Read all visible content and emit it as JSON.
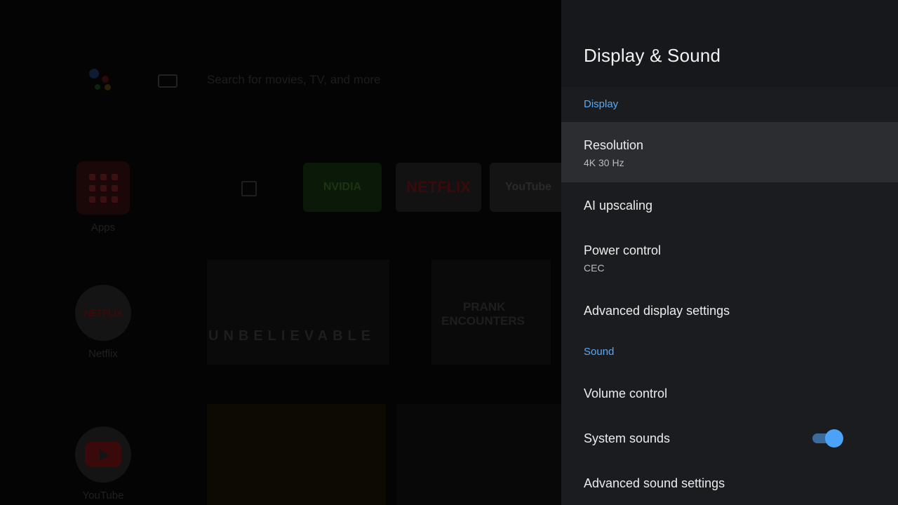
{
  "home": {
    "search_hint": "Search for movies, TV, and more",
    "rail": {
      "apps_label": "Apps",
      "netflix_label": "Netflix",
      "netflix_logo": "NETFLIX",
      "youtube_label": "YouTube"
    },
    "favorites": {
      "nvidia_label": "NVIDIA",
      "netflix_label": "NETFLIX",
      "youtube_label": "YouTube"
    },
    "posters": {
      "unbelievable": "UNBELIEVABLE",
      "prank_line1": "PRANK",
      "prank_line2": "ENCOUNTERS"
    }
  },
  "settings": {
    "title": "Display & Sound",
    "display_section": "Display",
    "sound_section": "Sound",
    "items": [
      {
        "title": "Resolution",
        "subtitle": "4K 30 Hz"
      },
      {
        "title": "AI upscaling"
      },
      {
        "title": "Power control",
        "subtitle": "CEC"
      },
      {
        "title": "Advanced display settings"
      },
      {
        "title": "Volume control"
      },
      {
        "title": "System sounds",
        "toggle_on": true
      },
      {
        "title": "Advanced sound settings"
      }
    ]
  },
  "colors": {
    "accent": "#4aa3f8",
    "section_label": "#5aa9f4",
    "panel_bg": "#1b1c1f",
    "focused_row": "#2c2d31"
  },
  "icons": {
    "assistant": "google-assistant-icon",
    "keyboard": "keyboard-icon",
    "apps": "apps-grid-icon",
    "external": "external-link-icon"
  }
}
